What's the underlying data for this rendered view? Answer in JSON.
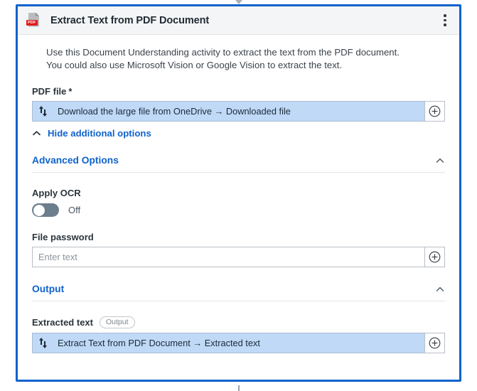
{
  "card": {
    "icon": "pdf-file-icon",
    "title": "Extract Text from PDF Document",
    "menu_icon": "kebab-menu-icon",
    "description": "Use this Document Understanding activity to extract the text from the PDF document.\nYou could also use Microsoft Vision or Google Vision to extract the text."
  },
  "colors": {
    "card_border": "#0f62cd",
    "link_blue": "#0f62cd",
    "filled_input": "#bfd9f7",
    "header_bg": "#f4f5f6",
    "toggle_off": "#6d7e8d",
    "pdf_badge": "#e0191c"
  },
  "fields": {
    "pdf_file": {
      "label": "PDF file",
      "required_marker": "*",
      "value": "Download the large file from OneDrive  →  Downloaded file",
      "variable_icon": "variable-arrows-icon",
      "add_button_icon": "plus-circle-icon"
    },
    "file_password": {
      "label": "File password",
      "value": "",
      "placeholder": "Enter text",
      "add_button_icon": "plus-circle-icon"
    },
    "extracted_text": {
      "label": "Extracted text",
      "badge": "Output",
      "value": "Extract Text from PDF Document  →  Extracted text",
      "variable_icon": "variable-arrows-icon",
      "add_button_icon": "plus-circle-icon"
    }
  },
  "additional_options_toggle": {
    "label": "Hide additional options",
    "icon": "chevron-up-icon",
    "expanded": true
  },
  "sections": {
    "advanced": {
      "title": "Advanced Options",
      "chevron": "chevron-up-icon"
    },
    "output": {
      "title": "Output",
      "chevron": "chevron-up-icon"
    }
  },
  "apply_ocr": {
    "label": "Apply OCR",
    "state_label": "Off",
    "checked": false
  }
}
